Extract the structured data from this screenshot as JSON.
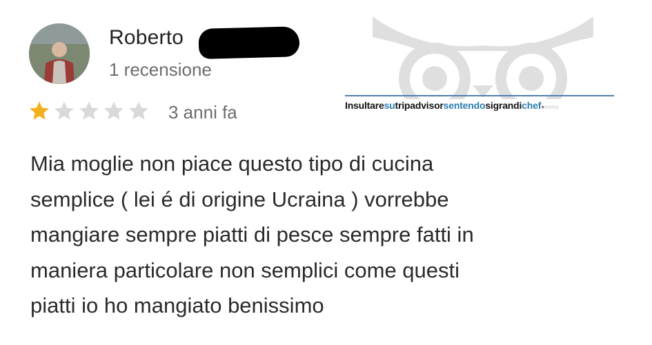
{
  "review": {
    "author": "Roberto",
    "review_count": "1 recensione",
    "rating": 1,
    "rating_max": 5,
    "time_ago": "3 anni fa",
    "text_lines": [
      "Mia moglie non piace questo tipo di cucina",
      "semplice ( lei é di origine Ucraina ) vorrebbe",
      "mangiare sempre piatti di pesce sempre fatti in",
      "maniera particolare non semplici come questi",
      "piatti io ho mangiato benissimo"
    ]
  },
  "watermark": {
    "part_a": "Insultare",
    "part_b": "su",
    "part_c": "tripadvisor",
    "part_d": "sentendo",
    "part_e": "sigrandi",
    "part_f": "chef",
    "part_g": "●○○○○",
    "logo_icon": "owl-eyes-icon"
  },
  "colors": {
    "star_filled": "#f2b01e",
    "star_empty": "#d9d9d9",
    "watermark_blue": "#2b7db0"
  }
}
